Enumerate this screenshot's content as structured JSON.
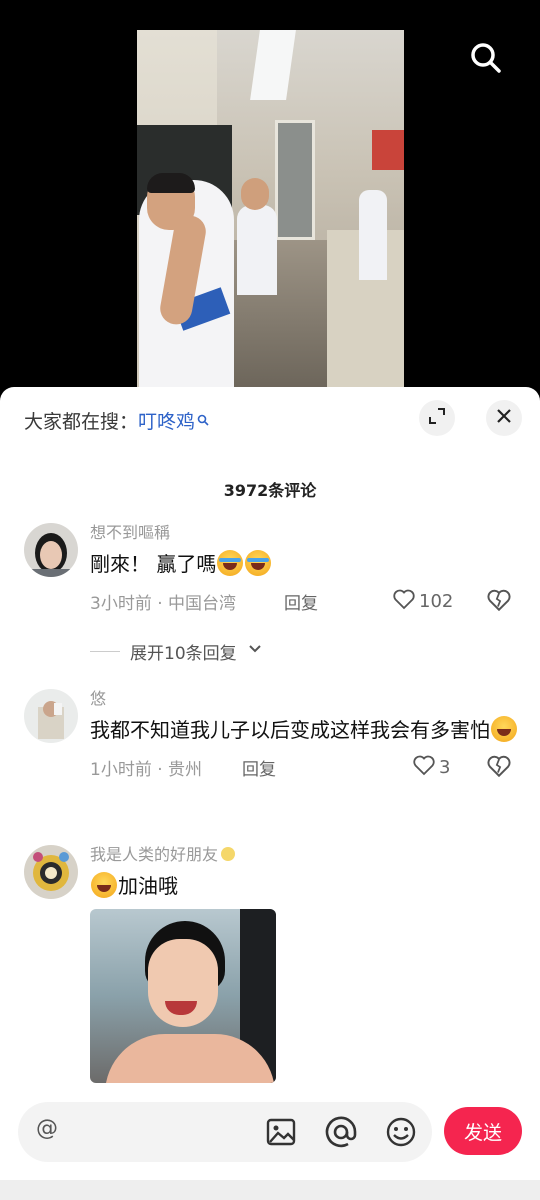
{
  "trending": {
    "prefix": "大家都在搜：",
    "term": "叮咚鸡"
  },
  "comments_count": "3972条评论",
  "comments": [
    {
      "user": "想不到嘔稱",
      "text": "剛來！ 贏了嗎",
      "time_location": "3小时前 · 中国台湾",
      "reply_label": "回复",
      "likes": "102",
      "expand_label": "展开10条回复"
    },
    {
      "user": "悠",
      "text": "我都不知道我儿子以后变成这样我会有多害怕",
      "time_location": "1小时前 · 贵州",
      "reply_label": "回复",
      "likes": "3"
    },
    {
      "user": "我是人类的好朋友",
      "text": "加油哦"
    }
  ],
  "input": {
    "placeholder": "@"
  },
  "send_label": "发送",
  "colors": {
    "accent": "#f5254f",
    "link": "#2d62c8"
  },
  "icons": [
    "search-icon",
    "expand-icon",
    "close-icon",
    "heart-icon",
    "broken-heart-icon",
    "chevron-down-icon",
    "image-icon",
    "at-icon",
    "emoji-icon"
  ]
}
